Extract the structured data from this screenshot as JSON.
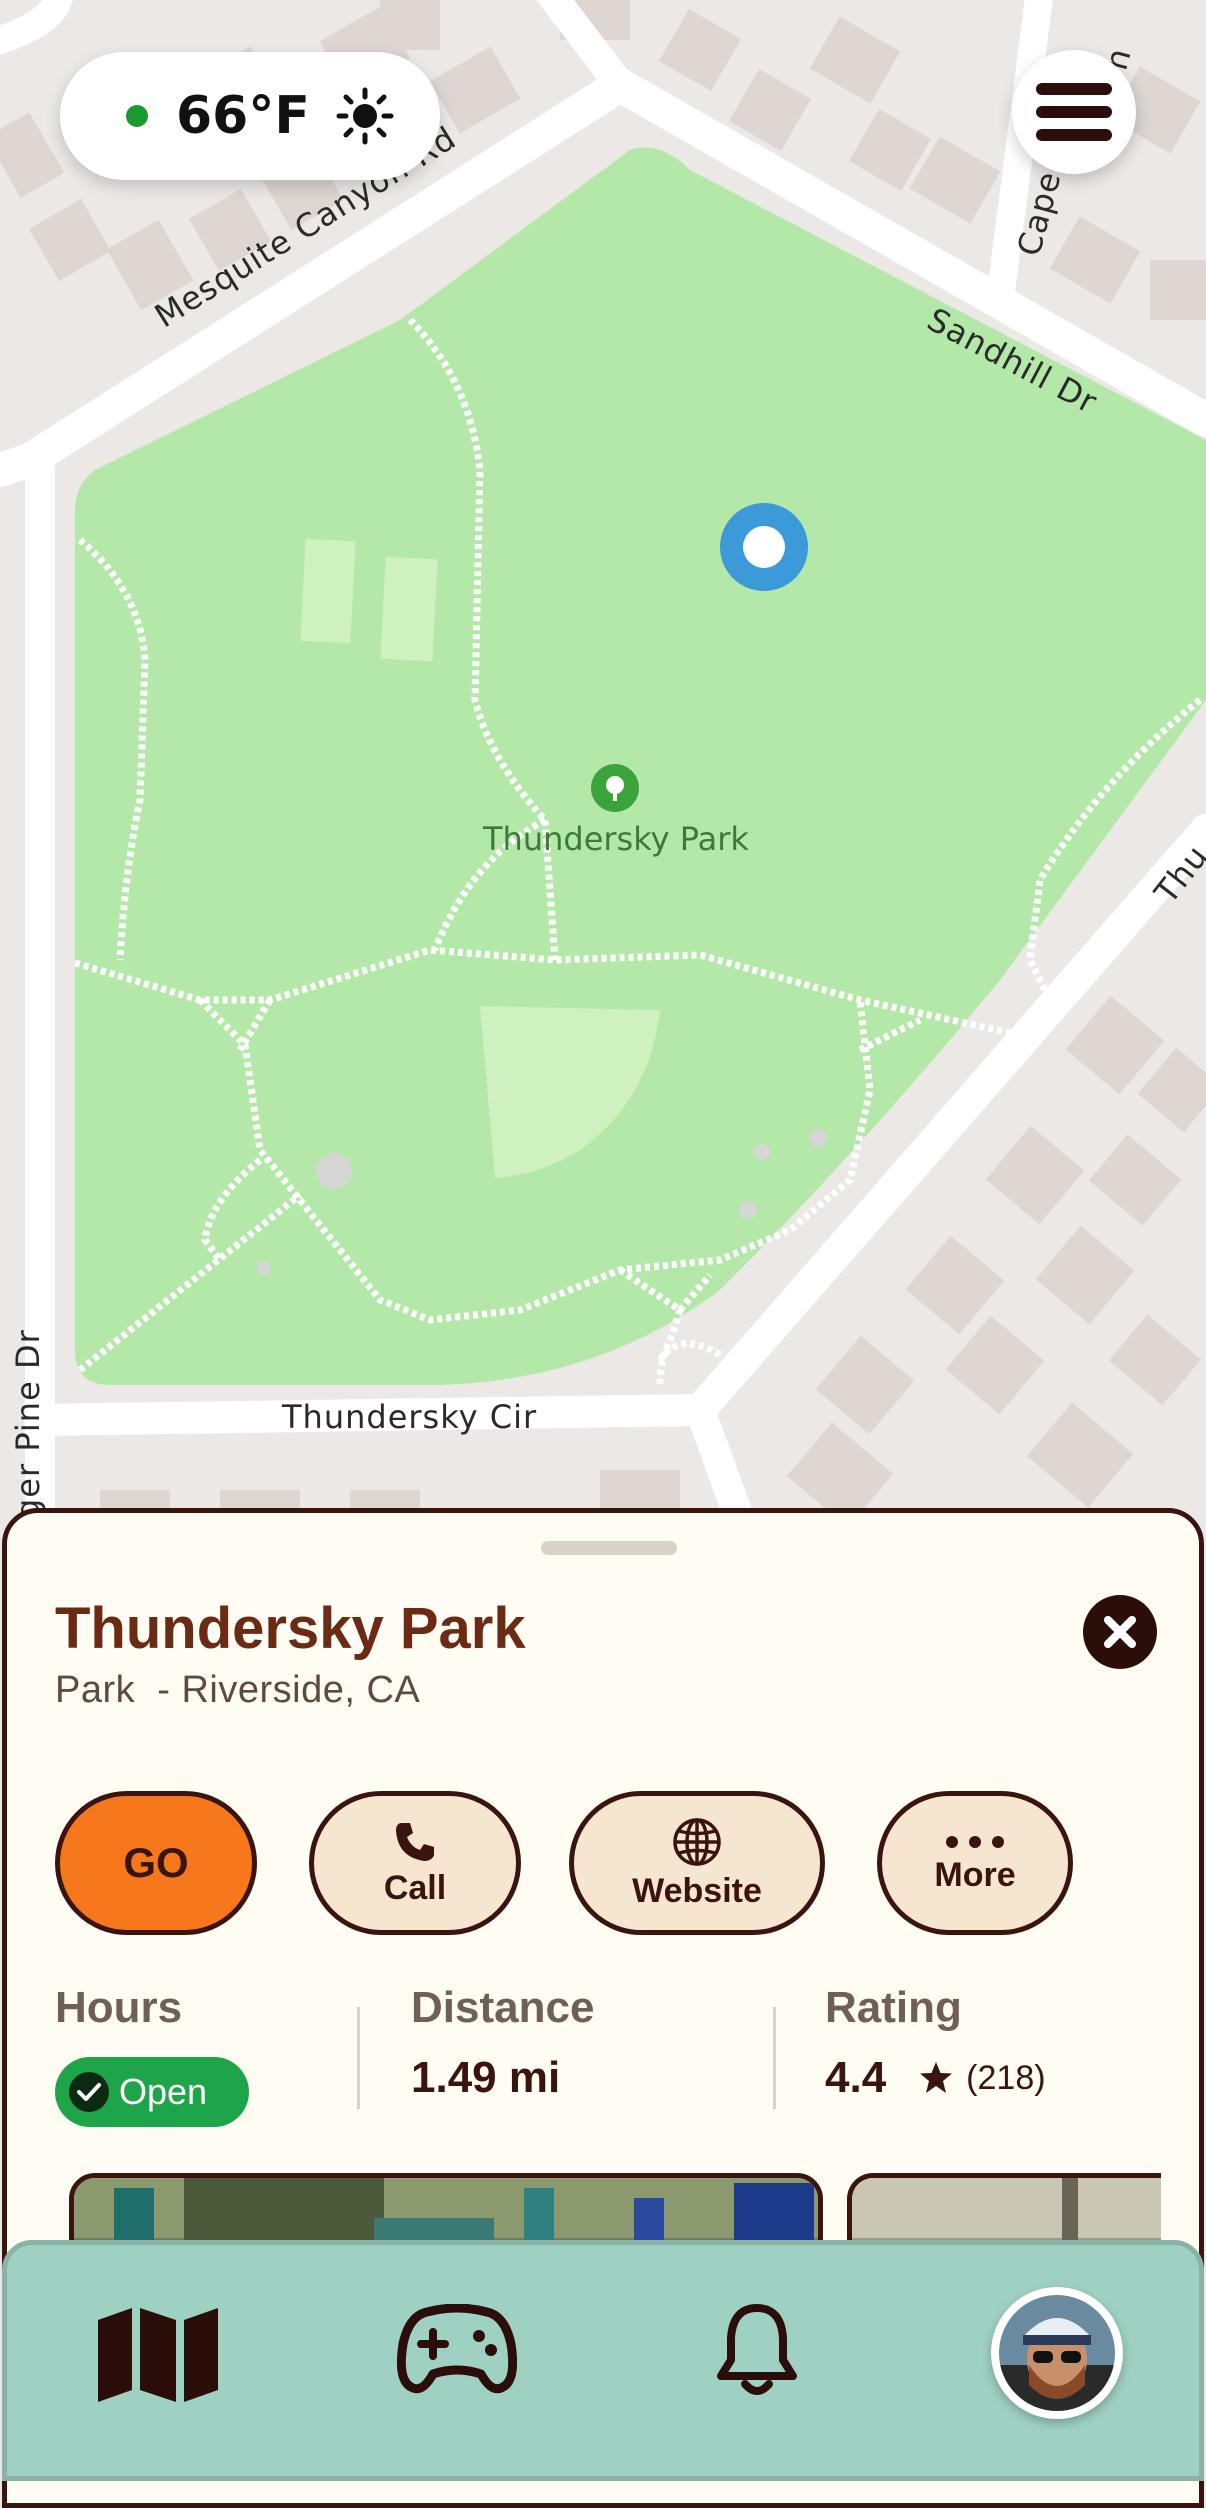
{
  "weather": {
    "temperature": "66°F",
    "status_color": "#1a9a2e",
    "icon": "sun-icon"
  },
  "map": {
    "streets": [
      "Mesquite Canyon Rd",
      "Sandhill Dr",
      "Cape",
      "Thundersky Cir",
      "ger Pine Dr",
      "Thu",
      "n"
    ],
    "poi_label": "Thundersky Park",
    "poi_icon": "tree-icon"
  },
  "place": {
    "title": "Thundersky Park",
    "subtitle": "Park  - Riverside, CA"
  },
  "actions": [
    {
      "label": "GO",
      "icon": ""
    },
    {
      "label": "Call",
      "icon": "phone-icon"
    },
    {
      "label": "Website",
      "icon": "globe-icon"
    },
    {
      "label": "More",
      "icon": "more-dots-icon"
    }
  ],
  "stats": {
    "hours_label": "Hours",
    "hours_status": "Open",
    "distance_label": "Distance",
    "distance_value": "1.49 mi",
    "rating_label": "Rating",
    "rating_value": "4.4",
    "rating_count": "(218)"
  },
  "nav": {
    "items": [
      "map-icon",
      "gamepad-icon",
      "bell-icon",
      "profile-avatar"
    ]
  },
  "colors": {
    "accent": "#f6781b",
    "brand_dark": "#3a1510",
    "title": "#6b2a14",
    "open_green": "#1ea54a",
    "park_green": "#b3e8a8",
    "nav_bg": "#9fd1c2"
  }
}
